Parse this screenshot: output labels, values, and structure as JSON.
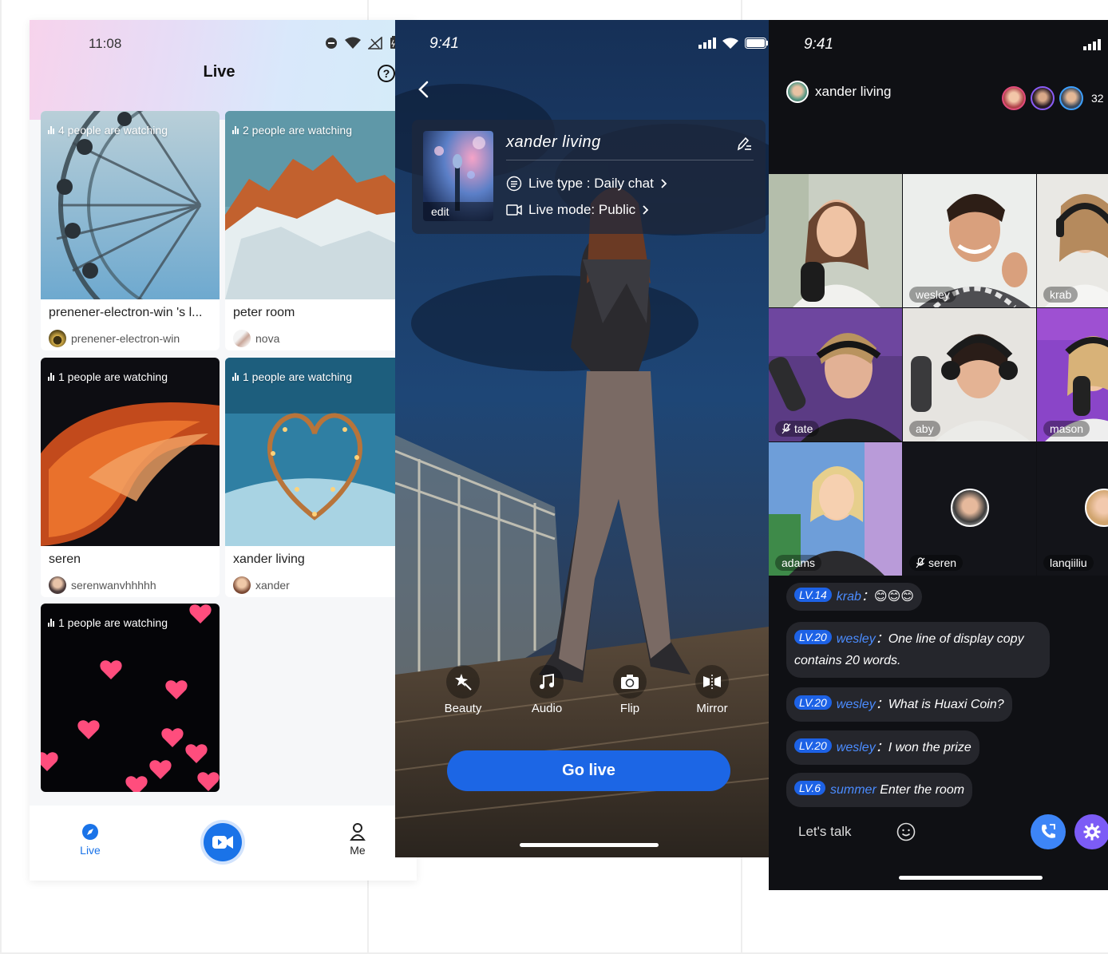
{
  "colors": {
    "brand_blue": "#1c66e5",
    "level_badge": "#1d62e6",
    "username_blue": "#4b8cff",
    "call_button": "#3d85f7",
    "settings_button": "#7c5cf6"
  },
  "screen1": {
    "time": "11:08",
    "title": "Live",
    "help_icon": "?",
    "rooms": [
      {
        "watching": "4 people are watching",
        "title": "prenener-electron-win 's l...",
        "user": "prenener-electron-win"
      },
      {
        "watching": "2 people are watching",
        "title": "peter room",
        "user": "nova"
      },
      {
        "watching": "1 people are watching",
        "title": "seren",
        "user": "serenwanvhhhhh"
      },
      {
        "watching": "1 people are watching",
        "title": "xander living",
        "user": "xander"
      },
      {
        "watching": "1 people are watching"
      }
    ],
    "nav": {
      "live": "Live",
      "me": "Me"
    }
  },
  "screen2": {
    "time": "9:41",
    "room_name": "xander  living",
    "cover_edit": "edit",
    "live_type": "Live type : Daily chat",
    "live_mode": "Live mode: Public",
    "tools": [
      "Beauty",
      "Audio",
      "Flip",
      "Mirror"
    ],
    "go_live": "Go live"
  },
  "screen3": {
    "time": "9:41",
    "host": "xander living",
    "viewer_count": "32",
    "tiles": [
      "",
      "wesley",
      "krab",
      "tate",
      "aby",
      "mason",
      "adams",
      "seren",
      "lanqiiliu"
    ],
    "messages": [
      {
        "level": "LV.14",
        "user": "krab",
        "text": "：😊😊😊"
      },
      {
        "level": "LV.20",
        "user": "wesley",
        "text": "：One line of display copy contains 20 words."
      },
      {
        "level": "LV.20",
        "user": "wesley",
        "text": "：What is Huaxi Coin?"
      },
      {
        "level": "LV.20",
        "user": "wesley",
        "text": "：I won the prize"
      },
      {
        "level": "LV.6",
        "user": "summer",
        "text": " Enter the room"
      }
    ],
    "input_placeholder": "Let's talk"
  }
}
